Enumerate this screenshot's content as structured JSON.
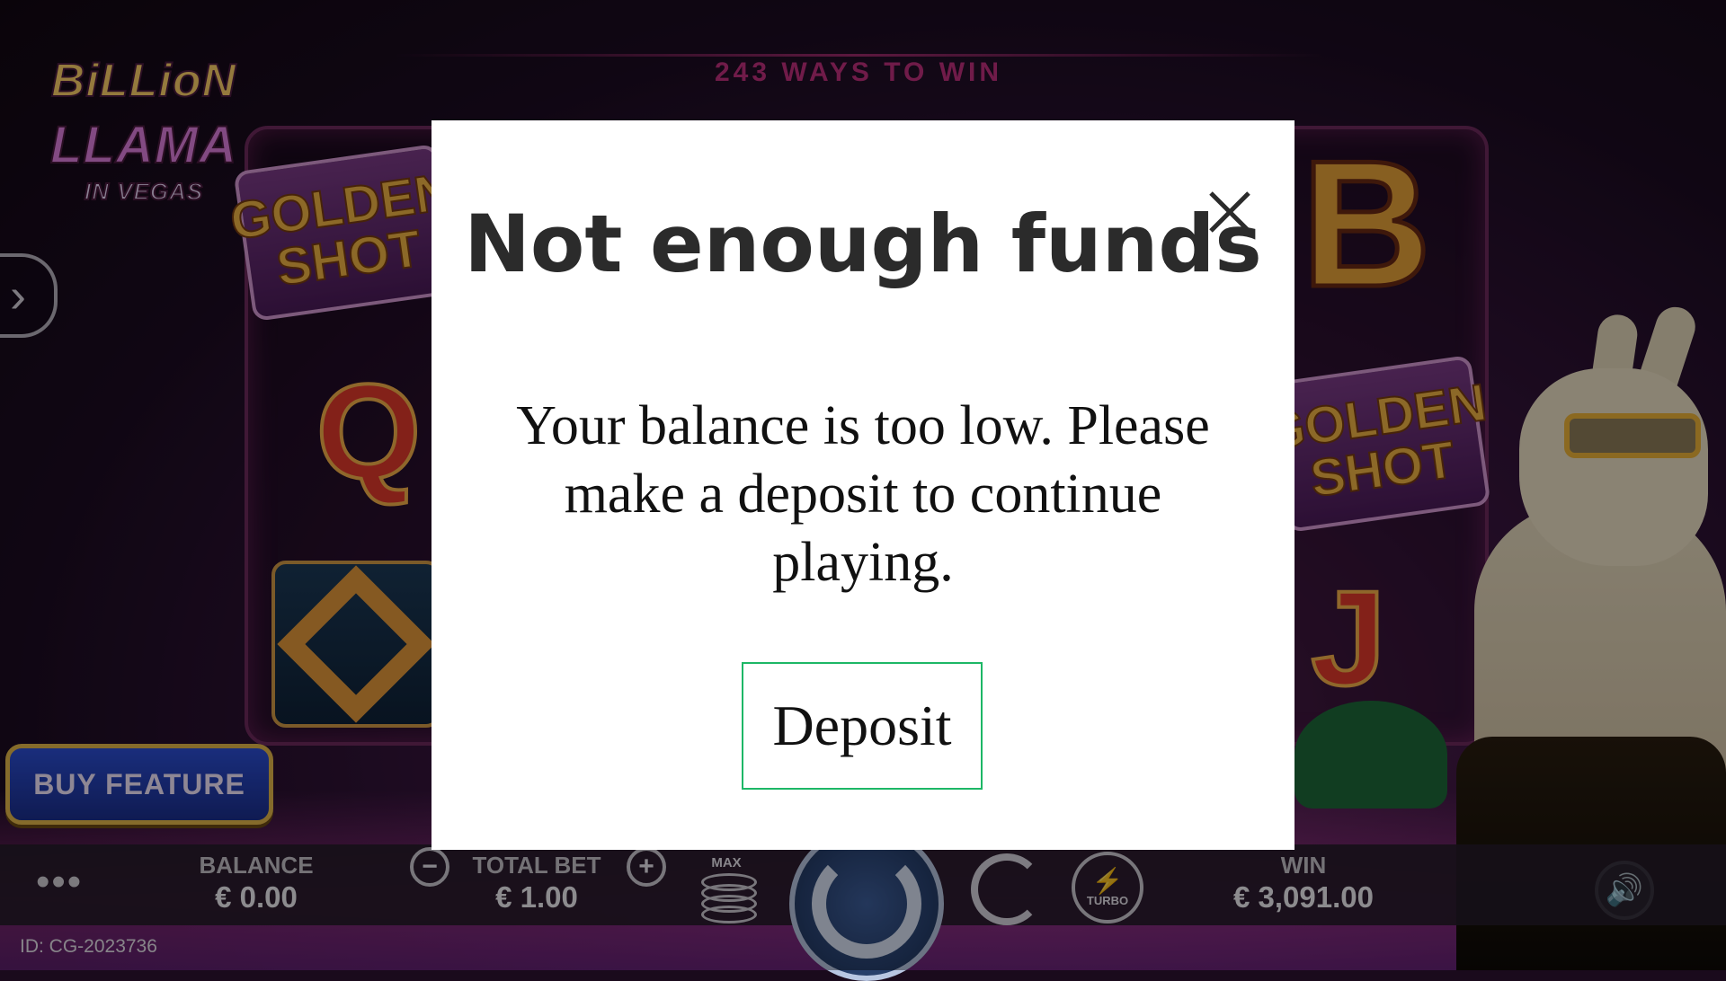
{
  "game": {
    "ways_text": "243 WAYS TO WIN",
    "logo": {
      "line1": "BiLLioN",
      "line2": "LLAMA",
      "line3": "IN VEGAS"
    },
    "symbols": {
      "golden_shot_left": "GOLDEN SHOT",
      "golden_shot_right": "GOLDEN SHOT",
      "q": "Q",
      "j": "J",
      "btc": "B"
    },
    "buy_feature_label": "BUY FEATURE",
    "side_arrow_icon": "chevron-right-icon"
  },
  "bottom_bar": {
    "menu_icon": "ellipsis-icon",
    "balance_label": "BALANCE",
    "balance_value": "€ 0.00",
    "total_bet_label": "TOTAL BET",
    "total_bet_value": "€ 1.00",
    "max_label": "MAX",
    "turbo_label": "TURBO",
    "win_label": "WIN",
    "win_value": "€ 3,091.00",
    "sound_icon": "speaker-icon"
  },
  "session_id": "ID: CG-2023736",
  "modal": {
    "title": "Not enough funds",
    "message": "Your balance is too low. Please make a deposit to continue playing.",
    "deposit_label": "Deposit",
    "close_icon": "close-icon",
    "accent_color": "#1db766"
  }
}
